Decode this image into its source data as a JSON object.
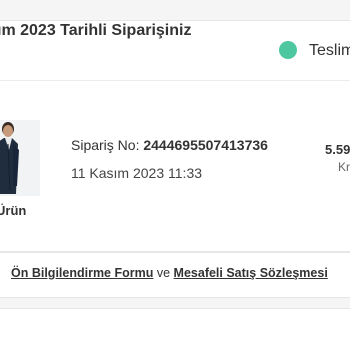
{
  "order": {
    "title": "ım 2023 Tarihli Siparişiniz",
    "status": "Teslim",
    "status_color": "#4dc7a0",
    "number_label": "Sipariş No:",
    "number_value": "2444695507413736",
    "date": "11 Kasım 2023 11:33",
    "price": "5.59",
    "price_sub": "Kr"
  },
  "product": {
    "caption": "Ürün",
    "thumbnail_icon": "product-jacket-icon"
  },
  "forms": {
    "link1": "Ön Bilgilendirme Formu",
    "connector": "ve",
    "link2": "Mesafeli Satış Sözleşmesi"
  }
}
